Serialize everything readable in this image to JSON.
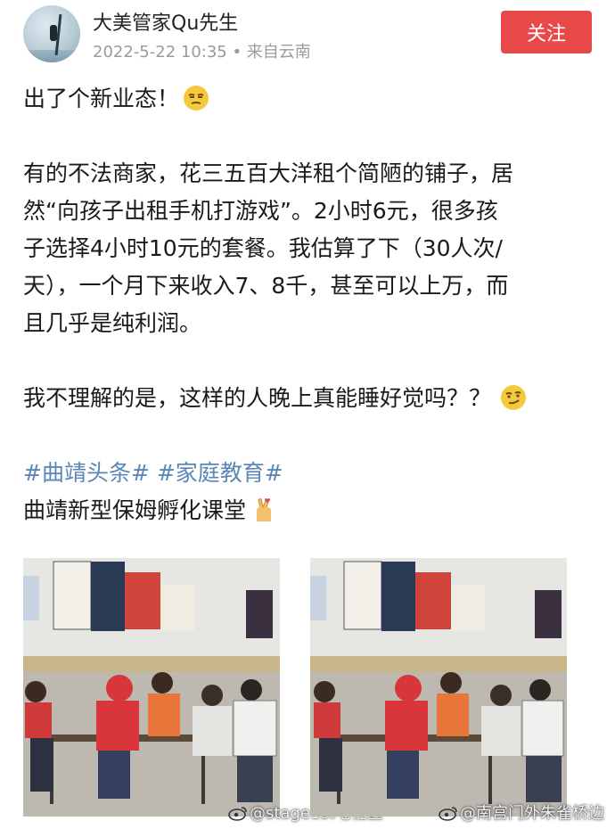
{
  "header": {
    "username": "大美管家Qu先生",
    "meta": "2022-5-22 10:35 • 来自云南",
    "follow_label": "关注"
  },
  "post": {
    "line1": "出了个新业态！",
    "p2": [
      "有的不法商家，花三五百大洋租个简陋的铺子，居",
      "然“向孩子出租手机打游戏”。2小时6元，很多孩",
      "子选择4小时10元的套餐。我估算了下（30人次/",
      "天），一个月下来收入7、8千，甚至可以上万，而",
      "且几乎是纯利润。"
    ],
    "p3": "我不理解的是，这样的人晚上真能睡好觉吗？？",
    "hashtags": [
      "#曲靖头条#",
      "#家庭教育#"
    ],
    "final_line": "曲靖新型保姆孵化课堂"
  },
  "images": {
    "watermark_left": "@stage1st宅社区",
    "watermark_right": "@南宫门外朱雀桥边"
  },
  "colors": {
    "follow_bg": "#e84a4a",
    "hashtag": "#5a87b6",
    "meta_text": "#9a9a9a"
  },
  "icons": [
    "smirk-emoji-icon",
    "smirk-face-emoji-icon",
    "finger-heart-emoji-icon",
    "weibo-logo-icon"
  ]
}
